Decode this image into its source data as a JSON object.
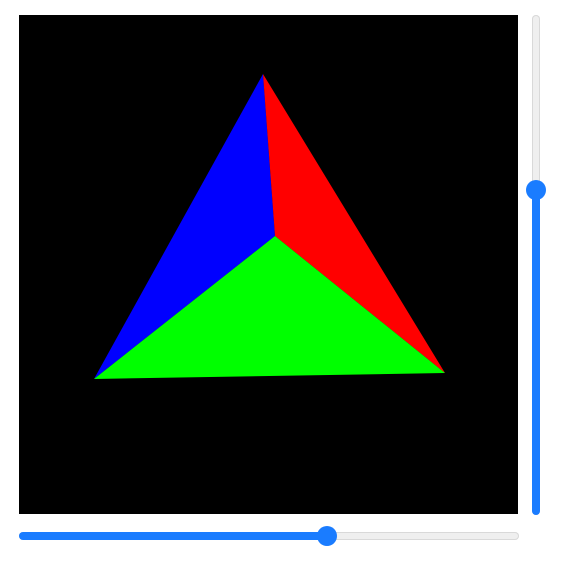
{
  "viewport": {
    "background": "#000000",
    "faces": [
      {
        "name": "blue-face",
        "color": "#0000ff"
      },
      {
        "name": "red-face",
        "color": "#ff0000"
      },
      {
        "name": "green-face",
        "color": "#00ff00"
      }
    ]
  },
  "sliders": {
    "vertical": {
      "value": 0.65,
      "accent": "#1a7cff"
    },
    "horizontal": {
      "value": 0.615,
      "accent": "#1a7cff"
    }
  }
}
